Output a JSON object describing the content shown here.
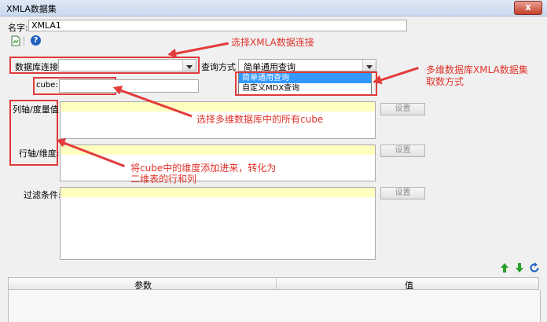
{
  "window": {
    "title": "XMLA数据集",
    "close_label": "x"
  },
  "name": {
    "label": "名字:",
    "value": "XMLA1"
  },
  "toolbar": {
    "icon1": "preview-icon",
    "icon2": "help-icon"
  },
  "connection": {
    "label": "数据库连接:",
    "value": ""
  },
  "query": {
    "label": "查询方式",
    "value": "简单通用查询",
    "options": [
      "简单通用查询",
      "自定义MDX查询"
    ]
  },
  "cube": {
    "label": "cube:",
    "value": ""
  },
  "column_axis": {
    "label": "列轴/度量值:",
    "button": "设置"
  },
  "row_axis": {
    "label": "行轴/维度:",
    "button": "设置"
  },
  "filter": {
    "label": "过滤条件:",
    "button": "设置"
  },
  "params_table": {
    "columns": [
      "参数",
      "值"
    ]
  },
  "annotations": {
    "select_conn": "选择XMLA数据连接",
    "query_line1": "多维数据库XMLA数据集",
    "query_line2": "取数方式",
    "select_cube": "选择多维数据库中的所有cube",
    "dims_line1": "将cube中的维度添加进来，转化为",
    "dims_line2": "二维表的行和列"
  },
  "colors": {
    "annotation": "#e0332b",
    "highlight": "#ffffc0",
    "selection": "#3399ff"
  }
}
